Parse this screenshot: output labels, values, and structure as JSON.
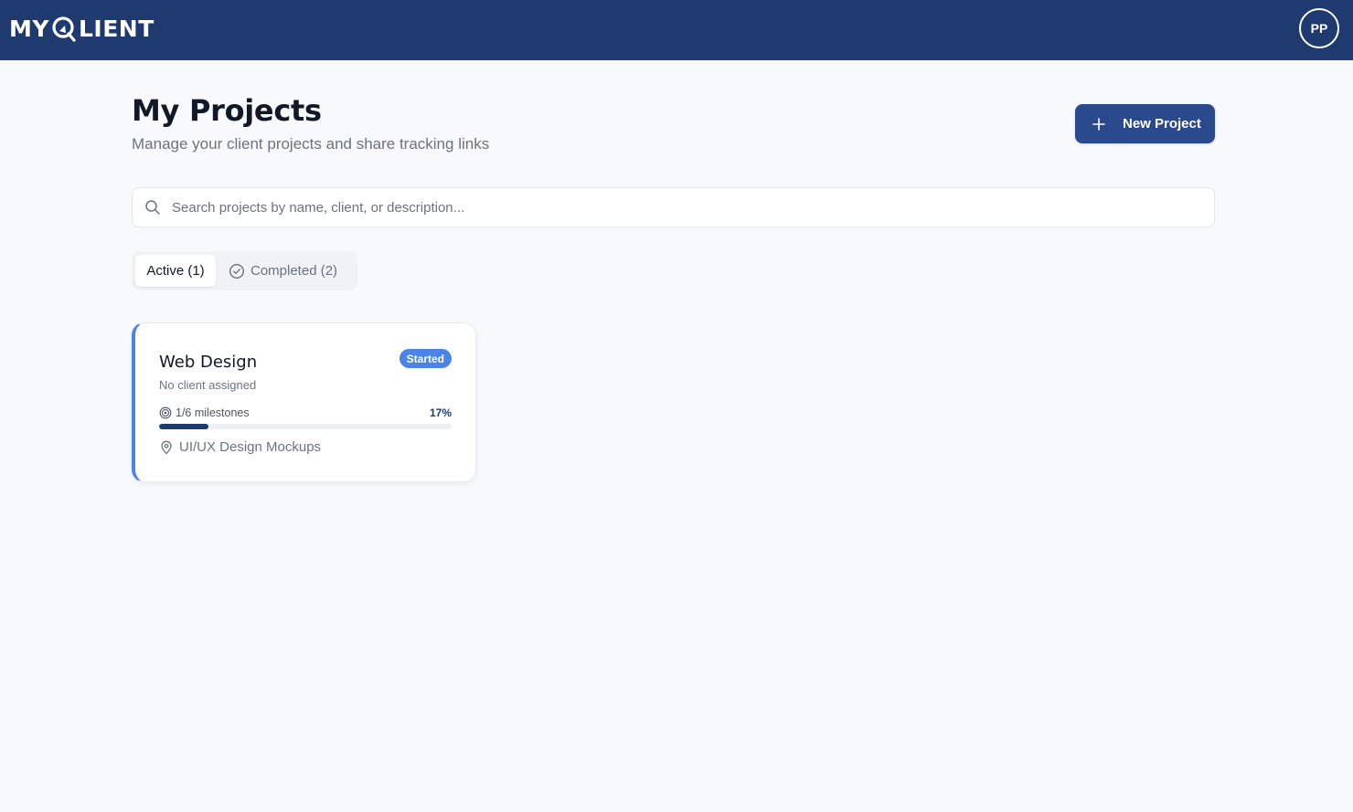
{
  "header": {
    "logo_text_left": "MY",
    "logo_text_right": "LIENT",
    "avatar_initials": "PP",
    "background": "#1e3a6e"
  },
  "page": {
    "title": "My Projects",
    "subtitle": "Manage your client projects and share tracking links",
    "new_project_label": "New Project",
    "new_project_icon": "plus-icon"
  },
  "search": {
    "placeholder": "Search projects by name, client, or description...",
    "value": "",
    "icon": "search-icon"
  },
  "tabs": [
    {
      "label": "Active (1)",
      "selected": true
    },
    {
      "label": "Completed (2)",
      "selected": false,
      "icon": "check-circle-icon"
    }
  ],
  "projects": [
    {
      "title": "Web Design",
      "status": "Started",
      "client": "No client assigned",
      "milestones": "1/6 milestones",
      "progress_label": "17%",
      "progress": 0.17,
      "next_milestone": "UI/UX Design Mockups",
      "accent": "#4a84e8"
    }
  ]
}
